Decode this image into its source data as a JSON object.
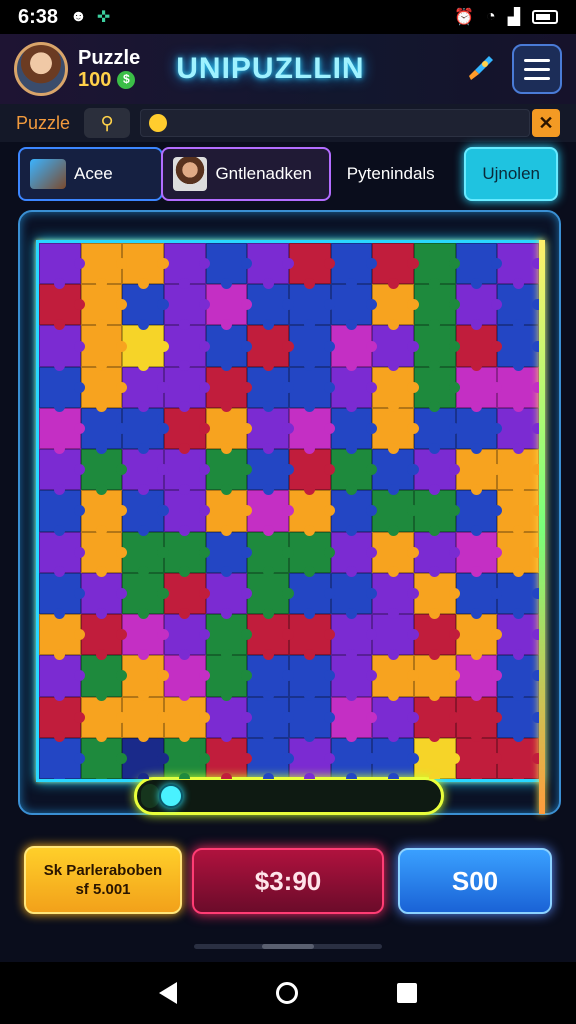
{
  "status_bar": {
    "time": "6:38",
    "icons": [
      "face-icon",
      "settings-icon",
      "alarm-icon",
      "wifi-icon",
      "signal-icon",
      "battery-icon"
    ]
  },
  "header": {
    "user_name": "Puzzle",
    "coins": "100",
    "coin_symbol": "$",
    "app_title": "UNIPUZLLIN",
    "rocket_icon": "rocket-icon",
    "menu_icon": "menu-icon"
  },
  "search": {
    "label": "Puzzle",
    "placeholder": "",
    "clear_label": "✕"
  },
  "tabs": [
    {
      "label": "Acee"
    },
    {
      "label": "Gntlenadken"
    },
    {
      "label": "Pytenindals"
    },
    {
      "label": "Ujnolen"
    }
  ],
  "board": {
    "palette": {
      "B": "#2346c4",
      "P": "#7b2bd2",
      "M": "#c42fc4",
      "O": "#f7a31f",
      "R": "#c11d3c",
      "G": "#1e8a3d",
      "Y": "#f6d428",
      "D": "#1a2a8a"
    },
    "rows": [
      "POOPBPRBRGBP",
      "ROBPMBBBOGPB",
      "POYPBRBMPGRB",
      "BOPPRBBPOGMM",
      "MBBROPMBOBBP",
      "PGPPGBRGBPOO",
      "BOBPOMOBGGBO",
      "POGGBGGPOPMO",
      "BPGRPGBBPOBB",
      "ORMPGRRPPROP",
      "PGOMGBBPOOMB",
      "ROOOPBBMPRRB",
      "BGDGRBPBBYRR"
    ]
  },
  "progress": {
    "fraction": 0.06
  },
  "buttons": {
    "left_line1": "Sk Parleraboben",
    "left_line2": "sf 5.001",
    "middle": "$3:90",
    "right": "S00"
  }
}
